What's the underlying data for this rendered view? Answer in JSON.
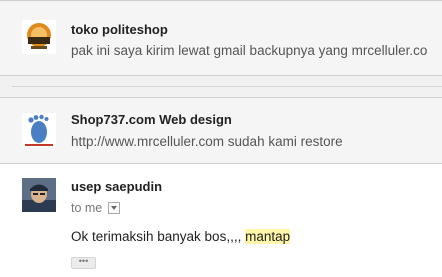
{
  "messages": [
    {
      "sender": "toko politeshop",
      "snippet": "pak ini saya kirim lewat gmail backupnya yang mrcelluler.co",
      "avatar_icon": "shop-logo-avatar"
    },
    {
      "sender": "Shop737.com Web design",
      "snippet": "http://www.mrcelluler.com sudah kami restore",
      "avatar_icon": "footprint-logo-avatar"
    },
    {
      "sender": "usep saepudin",
      "recipient": "to me",
      "body_before": "Ok terimaksih banyak bos,,,, ",
      "body_highlight": "mantap",
      "show_trimmed": "•••",
      "avatar_icon": "user-photo-avatar"
    }
  ],
  "colors": {
    "collapsed_bg": "#f5f5f5",
    "highlight": "#fff6a8"
  }
}
